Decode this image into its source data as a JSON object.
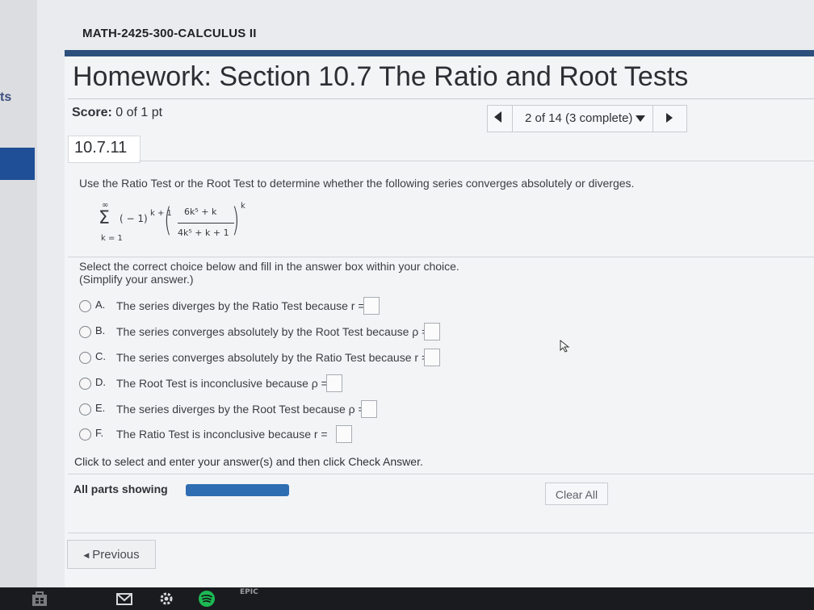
{
  "left_strip": {
    "text": "ts"
  },
  "course": {
    "title": "MATH-2425-300-CALCULUS II"
  },
  "homework": {
    "title": "Homework: Section 10.7 The Ratio and Root Tests"
  },
  "score": {
    "label": "Score:",
    "value": "0 of 1 pt"
  },
  "nav": {
    "status": "2 of 14 (3 complete)"
  },
  "question": {
    "number": "10.7.11",
    "instructions": "Use the Ratio Test or the Root Test to determine whether the following series converges absolutely or diverges.",
    "series": {
      "upper": "∞",
      "sigma": "Σ",
      "lower": "k = 1",
      "sign": "( − 1)",
      "sign_exp": "k + 1",
      "numerator": "6k⁵ + k",
      "denominator": "4k⁵ + k + 1",
      "outer_exp": "k"
    },
    "select_text": "Select the correct choice below and fill in the answer box within your choice.",
    "simplify": "(Simplify your answer.)",
    "choices": [
      {
        "letter": "A.",
        "text": "The series diverges by the Ratio Test because r ="
      },
      {
        "letter": "B.",
        "text": "The series converges absolutely by the Root Test because ρ ="
      },
      {
        "letter": "C.",
        "text": "The series converges absolutely by the Ratio Test because r ="
      },
      {
        "letter": "D.",
        "text": "The Root Test is inconclusive because ρ ="
      },
      {
        "letter": "E.",
        "text": "The series diverges by the Root Test because ρ ="
      },
      {
        "letter": "F.",
        "text": "The Ratio Test is inconclusive because r ="
      }
    ],
    "click_text": "Click to select and enter your answer(s) and then click Check Answer."
  },
  "footer": {
    "parts_label": "All parts showing",
    "clear_all": "Clear All",
    "previous": "Previous",
    "previous_arrow": "◀"
  },
  "taskbar": {
    "icons": [
      "store-icon",
      "mail-icon",
      "gear-icon",
      "spotify-icon",
      "epic-games-icon"
    ],
    "epic_text": "EPIC"
  },
  "colors": {
    "accent_bar": "#2d4f7c",
    "progress": "#2f6db3",
    "taskbar": "#1a1b1f"
  }
}
